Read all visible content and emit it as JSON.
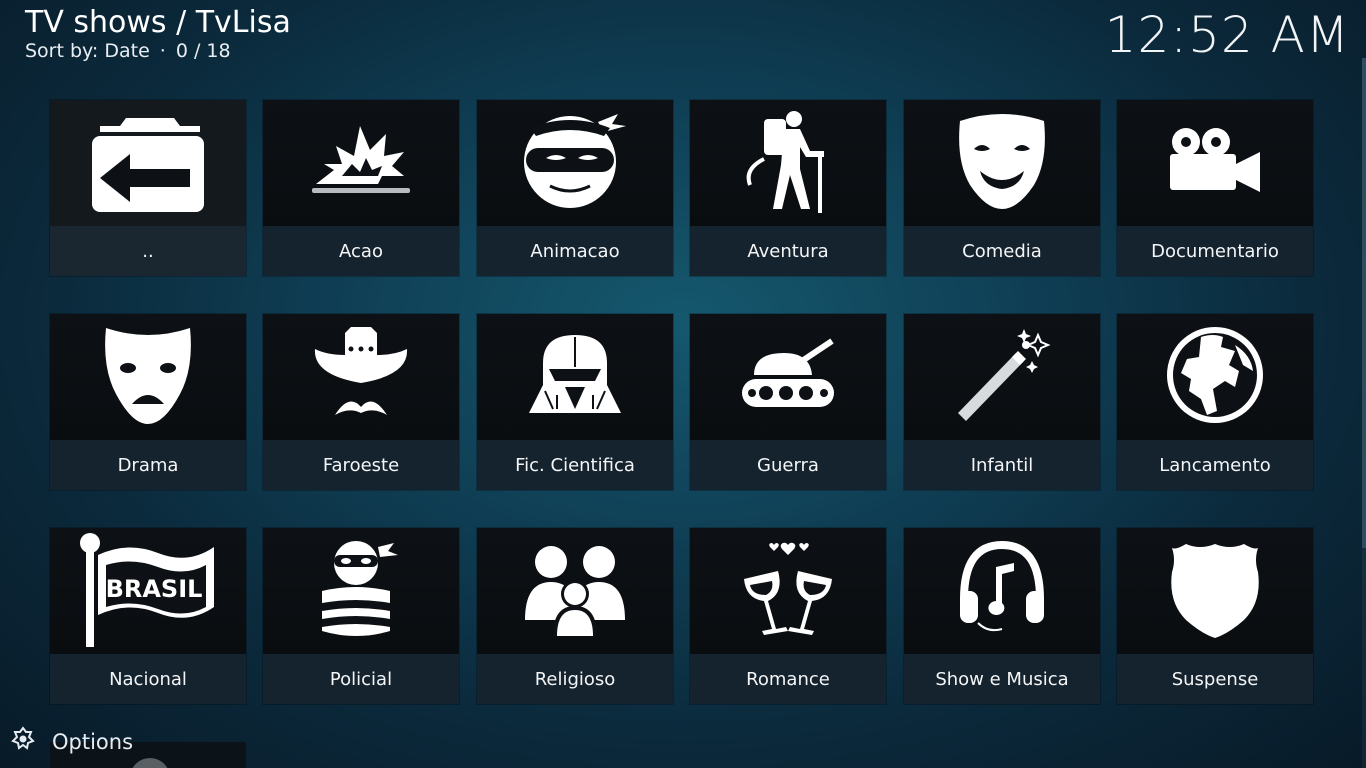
{
  "header": {
    "title": "TV shows / TvLisa",
    "sort_label": "Sort by: Date",
    "separator": "·",
    "count": "0 / 18"
  },
  "clock": "12:52 AM",
  "items": [
    {
      "label": "..",
      "icon": "back-folder-icon"
    },
    {
      "label": "Acao",
      "icon": "explosion-icon"
    },
    {
      "label": "Animacao",
      "icon": "ninja-icon"
    },
    {
      "label": "Aventura",
      "icon": "hiker-icon"
    },
    {
      "label": "Comedia",
      "icon": "comedy-mask-icon"
    },
    {
      "label": "Documentario",
      "icon": "movie-camera-icon"
    },
    {
      "label": "Drama",
      "icon": "drama-mask-icon"
    },
    {
      "label": "Faroeste",
      "icon": "cowboy-hat-icon"
    },
    {
      "label": "Fic. Cientifica",
      "icon": "darth-vader-icon"
    },
    {
      "label": "Guerra",
      "icon": "tank-icon"
    },
    {
      "label": "Infantil",
      "icon": "magic-wand-icon"
    },
    {
      "label": "Lancamento",
      "icon": "globe-icon"
    },
    {
      "label": "Nacional",
      "icon": "brasil-flag-icon",
      "flag_text": "BRASIL"
    },
    {
      "label": "Policial",
      "icon": "robber-icon"
    },
    {
      "label": "Religioso",
      "icon": "family-icon"
    },
    {
      "label": "Romance",
      "icon": "wine-glasses-icon"
    },
    {
      "label": "Show e Musica",
      "icon": "headphones-icon"
    },
    {
      "label": "Suspense",
      "icon": "shield-icon"
    }
  ],
  "options_label": "Options"
}
